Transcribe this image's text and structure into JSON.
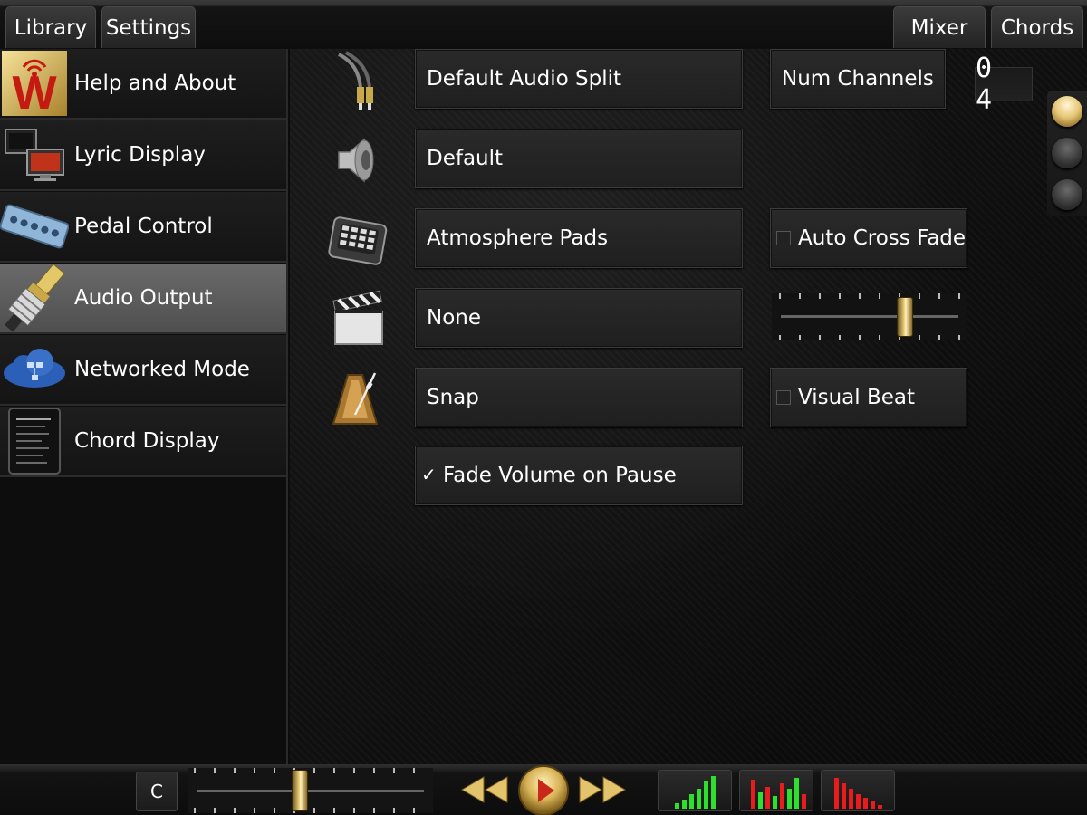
{
  "top_tabs": {
    "library": "Library",
    "settings": "Settings",
    "mixer": "Mixer",
    "chords": "Chords"
  },
  "sidebar": {
    "items": [
      {
        "label": "Help and About",
        "icon": "w-logo-icon",
        "active": false
      },
      {
        "label": "Lyric Display",
        "icon": "monitors-icon",
        "active": false
      },
      {
        "label": "Pedal Control",
        "icon": "pedal-board-icon",
        "active": false
      },
      {
        "label": "Audio Output",
        "icon": "audio-cable-icon",
        "active": true
      },
      {
        "label": "Networked Mode",
        "icon": "cloud-network-icon",
        "active": false
      },
      {
        "label": "Chord Display",
        "icon": "chord-sheet-icon",
        "active": false
      }
    ]
  },
  "settings": {
    "audio_split": "Default Audio Split",
    "num_channels_label": "Num Channels",
    "num_channels_value": "0 4",
    "output_device": "Default",
    "pads": "Atmosphere Pads",
    "auto_cross_fade": {
      "label": "Auto Cross Fade",
      "checked": false
    },
    "video": "None",
    "crossfade_level": 0.72,
    "metronome": "Snap",
    "visual_beat": {
      "label": "Visual Beat",
      "checked": false
    },
    "fade_volume_on_pause": {
      "label": "Fade Volume on Pause",
      "checked": true,
      "mark": "✓"
    }
  },
  "side_selector": {
    "count": 3,
    "selected": 0
  },
  "bottom_bar": {
    "key": "C",
    "position": 0.45,
    "meters": [
      "green-meter-icon",
      "red-green-meter-icon",
      "red-meter-icon"
    ]
  },
  "colors": {
    "gold": "#e2c46c",
    "meter_green": "#2ee02e",
    "meter_red": "#e81c1c",
    "active_item": "#5c5c5c"
  }
}
